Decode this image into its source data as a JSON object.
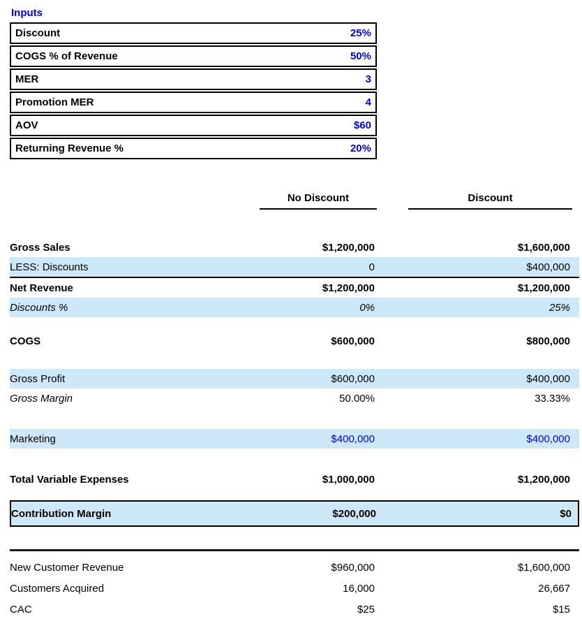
{
  "colors": {
    "input_text_blue": "#0000ee",
    "row_highlight_blue": "#cde9f9",
    "border_black": "#000000"
  },
  "inputs": {
    "title": "Inputs",
    "rows": [
      {
        "label": "Discount",
        "value": "25%"
      },
      {
        "label": "COGS % of Revenue",
        "value": "50%"
      },
      {
        "label": "MER",
        "value": "3"
      },
      {
        "label": "Promotion MER",
        "value": "4"
      },
      {
        "label": "AOV",
        "value": "$60"
      },
      {
        "label": "Returning Revenue %",
        "value": "20%"
      }
    ]
  },
  "comparison": {
    "columns": {
      "col1": "No Discount",
      "col2": "Discount"
    },
    "rows": [
      {
        "label": "Gross Sales",
        "v1": "$1,200,000",
        "v2": "$1,600,000"
      },
      {
        "label": "LESS: Discounts",
        "v1": "0",
        "v2": "$400,000"
      },
      {
        "label": "Net Revenue",
        "v1": "$1,200,000",
        "v2": "$1,200,000"
      },
      {
        "label": "Discounts %",
        "v1": "0%",
        "v2": "25%"
      },
      {
        "label": "COGS",
        "v1": "$600,000",
        "v2": "$800,000"
      },
      {
        "label": "Gross Profit",
        "v1": "$600,000",
        "v2": "$400,000"
      },
      {
        "label": "Gross Margin",
        "v1": "50.00%",
        "v2": "33.33%"
      },
      {
        "label": "Marketing",
        "v1": "$400,000",
        "v2": "$400,000"
      },
      {
        "label": "Total Variable Expenses",
        "v1": "$1,000,000",
        "v2": "$1,200,000"
      },
      {
        "label": "Contribution Margin",
        "v1": "$200,000",
        "v2": "$0"
      }
    ]
  },
  "acquisition": {
    "rows": [
      {
        "label": "New Customer Revenue",
        "v1": "$960,000",
        "v2": "$1,600,000"
      },
      {
        "label": "Customers Acquired",
        "v1": "16,000",
        "v2": "26,667"
      },
      {
        "label": "CAC",
        "v1": "$25",
        "v2": "$15"
      }
    ]
  }
}
